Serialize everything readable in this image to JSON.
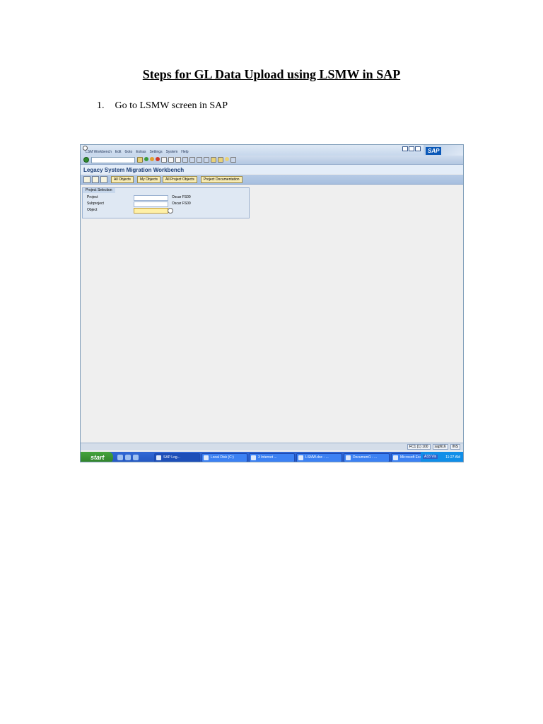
{
  "document": {
    "title": "Steps for GL Data Upload using LSMW in SAP",
    "step_number": "1.",
    "step_text": "Go to LSMW screen in SAP"
  },
  "sap_screen": {
    "menu": [
      "LSM Workbench",
      "Edit",
      "Goto",
      "Extras",
      "Settings",
      "System",
      "Help"
    ],
    "logo": "SAP",
    "screen_title": "Legacy System Migration Workbench",
    "buttons": {
      "all_objects": "All Objects",
      "my_objects": "My Objects",
      "all_project_objects": "All Project Objects",
      "project_documentation": "Project Documentation"
    },
    "group": {
      "title": "Project Selection",
      "project_label": "Project",
      "project_value": "Oscar FS00",
      "subproject_label": "Subproject",
      "subproject_value": "Oscar FS00",
      "object_label": "Object"
    },
    "status": {
      "system": "FC1 (1) 100",
      "server": "sapfi16",
      "mode": "INS"
    }
  },
  "taskbar": {
    "start": "start",
    "tasks": [
      "SAP Log...",
      "Local Disk (C:)",
      "3 Internet ...",
      "LSMW.doc - ...",
      "Document1 - ...",
      "Microsoft Exc..."
    ],
    "lang": "A33 Vis",
    "clock": "11:27 AM"
  }
}
